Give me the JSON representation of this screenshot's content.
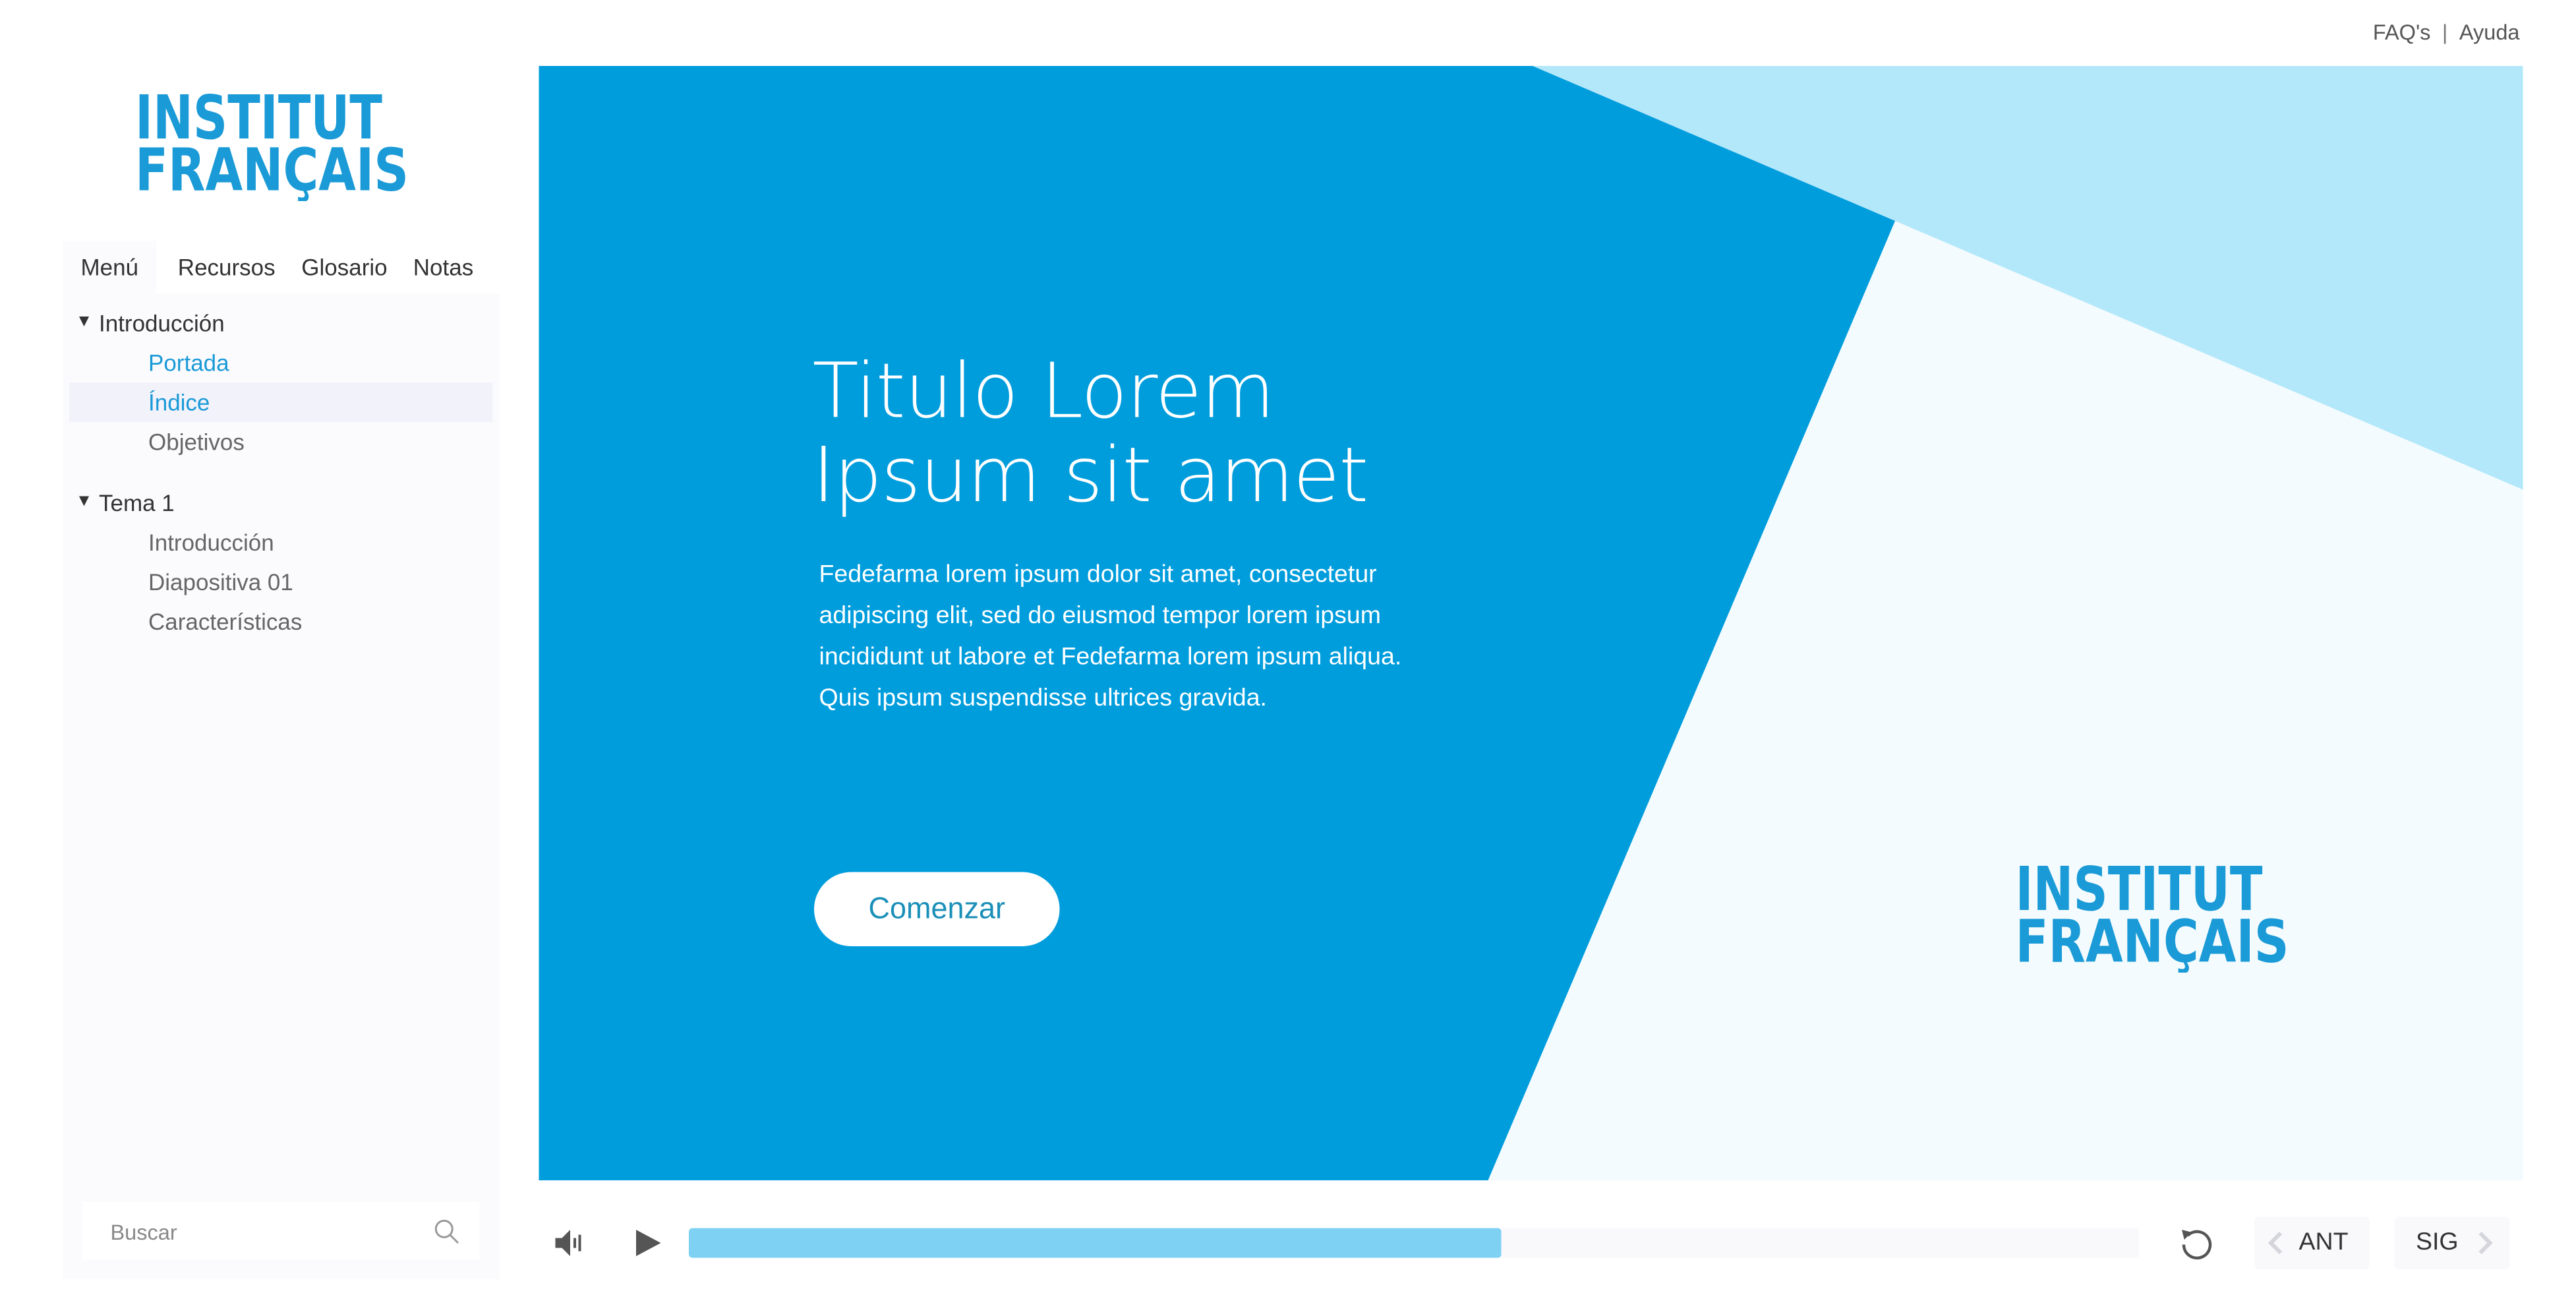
{
  "header": {
    "faq_label": "FAQ's",
    "separator": "|",
    "help_label": "Ayuda"
  },
  "brand": {
    "logo_text": "INSTITUT FRANÇAIS",
    "color": "#1a9ad6"
  },
  "sidebar": {
    "tabs": [
      {
        "label": "Menú",
        "active": true
      },
      {
        "label": "Recursos",
        "active": false
      },
      {
        "label": "Glosario",
        "active": false
      },
      {
        "label": "Notas",
        "active": false
      }
    ],
    "groups": [
      {
        "label": "Introducción",
        "expanded": true,
        "items": [
          {
            "label": "Portada",
            "state": "visited"
          },
          {
            "label": "Índice",
            "state": "current"
          },
          {
            "label": "Objetivos",
            "state": "default"
          }
        ]
      },
      {
        "label": "Tema 1",
        "expanded": true,
        "items": [
          {
            "label": "Introducción",
            "state": "default"
          },
          {
            "label": "Diapositiva 01",
            "state": "default"
          },
          {
            "label": "Características",
            "state": "default"
          }
        ]
      }
    ],
    "search": {
      "placeholder": "Buscar",
      "value": ""
    }
  },
  "slide": {
    "title_line1": "Titulo Lorem",
    "title_line2": "Ipsum sit amet",
    "body": "Fedefarma lorem ipsum dolor sit amet, consectetur adipiscing elit, sed do eiusmod tempor  lorem ipsum incididunt ut labore et Fedefarma lorem ipsum aliqua. Quis ipsum suspendisse ultrices gravida.",
    "start_button": "Comenzar",
    "colors": {
      "primary": "#009ddd",
      "light": "#b3e8fb",
      "pale": "#f3fbfe"
    }
  },
  "player": {
    "progress_fraction": 0.56,
    "progress_color": "#7fd1f4",
    "prev_label": "ANT",
    "next_label": "SIG",
    "icons": [
      "volume-icon",
      "play-icon",
      "replay-icon",
      "chevron-left-icon",
      "chevron-right-icon"
    ]
  }
}
